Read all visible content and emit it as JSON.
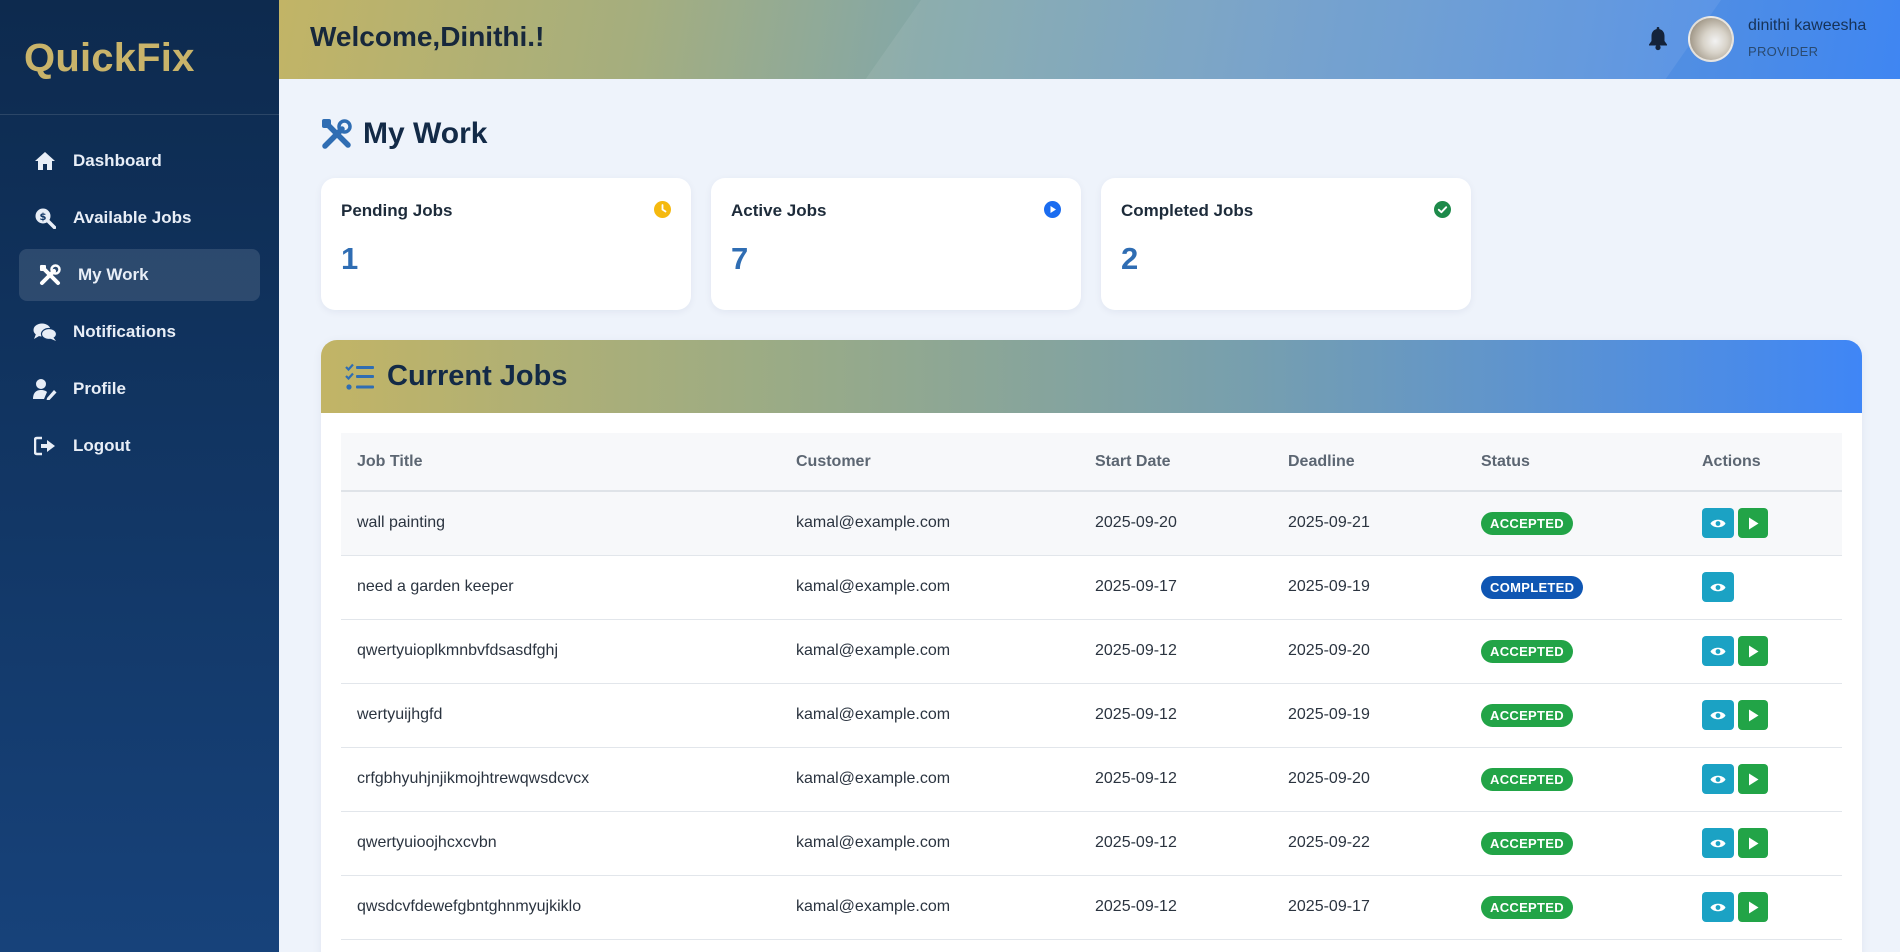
{
  "brand": "QuickFix",
  "sidebar": {
    "items": [
      {
        "label": "Dashboard",
        "icon": "home-icon"
      },
      {
        "label": "Available Jobs",
        "icon": "search-dollar-icon"
      },
      {
        "label": "My Work",
        "icon": "tools-icon",
        "active": true
      },
      {
        "label": "Notifications",
        "icon": "comments-icon"
      },
      {
        "label": "Profile",
        "icon": "user-edit-icon"
      },
      {
        "label": "Logout",
        "icon": "sign-out-icon"
      }
    ]
  },
  "header": {
    "welcome": "Welcome,Dinithi.!",
    "user_name": "dinithi kaweesha",
    "user_role": "PROVIDER"
  },
  "page_title": "My Work",
  "stats": [
    {
      "label": "Pending Jobs",
      "value": "1",
      "color": "#f5b90f"
    },
    {
      "label": "Active Jobs",
      "value": "7",
      "color": "#1a6cf0"
    },
    {
      "label": "Completed Jobs",
      "value": "2",
      "color": "#1d8a4a"
    }
  ],
  "jobs": {
    "title": "Current Jobs",
    "columns": [
      "Job Title",
      "Customer",
      "Start Date",
      "Deadline",
      "Status",
      "Actions"
    ],
    "rows": [
      {
        "title": "wall painting",
        "customer": "kamal@example.com",
        "start": "2025-09-20",
        "deadline": "2025-09-21",
        "status": "ACCEPTED"
      },
      {
        "title": "need a garden keeper",
        "customer": "kamal@example.com",
        "start": "2025-09-17",
        "deadline": "2025-09-19",
        "status": "COMPLETED"
      },
      {
        "title": "qwertyuioplkmnbvfdsasdfghj",
        "customer": "kamal@example.com",
        "start": "2025-09-12",
        "deadline": "2025-09-20",
        "status": "ACCEPTED"
      },
      {
        "title": "wertyuijhgfd",
        "customer": "kamal@example.com",
        "start": "2025-09-12",
        "deadline": "2025-09-19",
        "status": "ACCEPTED"
      },
      {
        "title": "crfgbhyuhjnjikmojhtrewqwsdcvcx",
        "customer": "kamal@example.com",
        "start": "2025-09-12",
        "deadline": "2025-09-20",
        "status": "ACCEPTED"
      },
      {
        "title": "qwertyuioojhcxcvbn",
        "customer": "kamal@example.com",
        "start": "2025-09-12",
        "deadline": "2025-09-22",
        "status": "ACCEPTED"
      },
      {
        "title": "qwsdcvfdewefgbntghnmyujkiklo",
        "customer": "kamal@example.com",
        "start": "2025-09-12",
        "deadline": "2025-09-17",
        "status": "ACCEPTED"
      }
    ]
  }
}
